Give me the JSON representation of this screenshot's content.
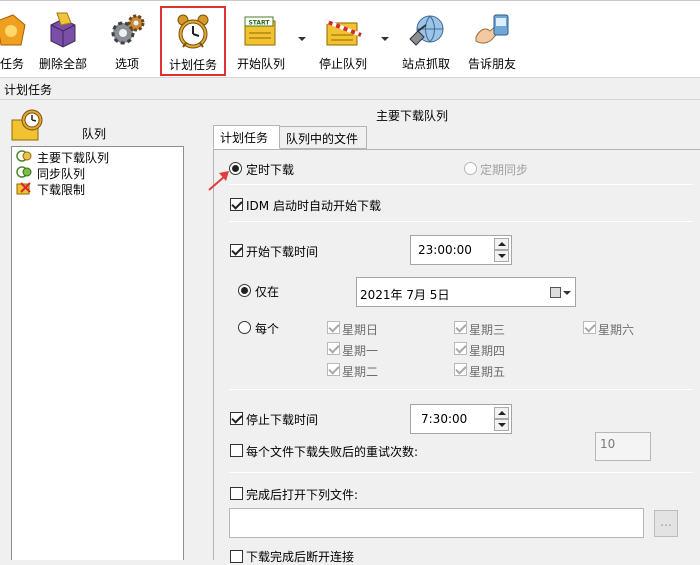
{
  "toolbar": {
    "items": [
      {
        "label": "任务",
        "icon": "task-icon"
      },
      {
        "label": "删除全部",
        "icon": "delete-all-icon"
      },
      {
        "label": "选项",
        "icon": "gears-icon"
      },
      {
        "label": "计划任务",
        "icon": "alarm-clock-icon"
      },
      {
        "label": "开始队列",
        "icon": "start-queue-icon"
      },
      {
        "label": "停止队列",
        "icon": "stop-queue-icon"
      },
      {
        "label": "站点抓取",
        "icon": "site-grabber-icon"
      },
      {
        "label": "告诉朋友",
        "icon": "tell-friend-icon"
      }
    ],
    "start_badge": "START"
  },
  "window_title": "计划任务",
  "left_panel": {
    "header": "队列",
    "queues": [
      {
        "label": "主要下载队列"
      },
      {
        "label": "同步队列"
      },
      {
        "label": "下载限制"
      }
    ]
  },
  "right_panel": {
    "title": "主要下载队列",
    "tabs": [
      {
        "label": "计划任务",
        "active": true
      },
      {
        "label": "队列中的文件",
        "active": false
      }
    ]
  },
  "schedule": {
    "mode_timed": "定时下载",
    "mode_sync": "定期同步",
    "auto_start": "IDM 启动时自动开始下载",
    "start_time_label": "开始下载时间",
    "start_time": "23:00:00",
    "only_on": "仅在",
    "date": "2021年  7月  5日",
    "every": "每个",
    "weekdays": [
      "星期日",
      "星期三",
      "星期六",
      "星期一",
      "星期四",
      "星期二",
      "星期五"
    ],
    "stop_time_label": "停止下载时间",
    "stop_time": "7:30:00",
    "retry_label": "每个文件下载失败后的重试次数:",
    "retry_count": "10",
    "open_file_label": "完成后打开下列文件:",
    "open_file_path": "",
    "browse_label": "...",
    "disconnect_label": "下载完成后断开连接"
  },
  "colors": {
    "highlight_border": "#e0312f",
    "annotation_arrow": "#e23b3b"
  }
}
